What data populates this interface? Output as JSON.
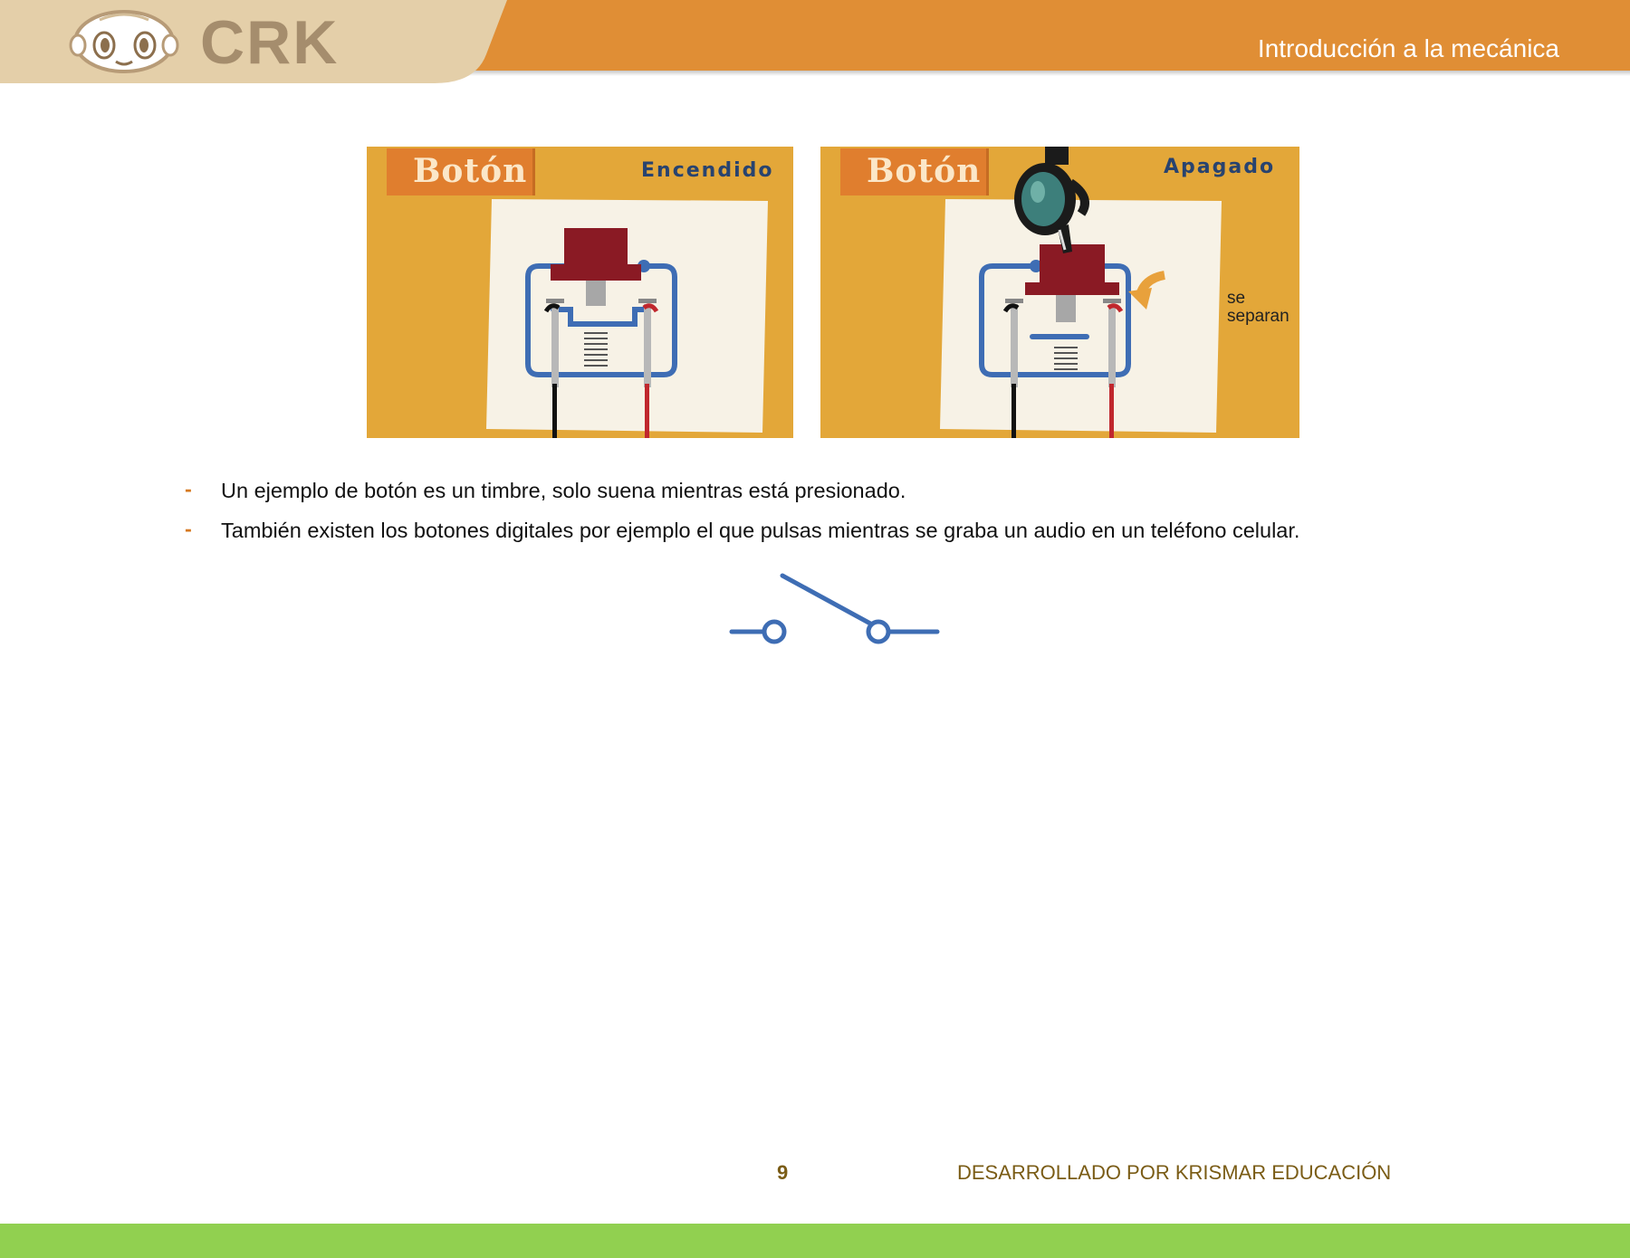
{
  "header": {
    "logo_text": "CRK",
    "title": "Introducción a la mecánica"
  },
  "figures": [
    {
      "tag": "Botón",
      "state": "Encendido"
    },
    {
      "tag": "Botón",
      "state": "Apagado",
      "annotation": [
        "se",
        "separan"
      ]
    }
  ],
  "bullets": [
    "Un ejemplo de botón es un timbre, solo suena mientras está presionado.",
    "También existen los botones digitales por ejemplo el que pulsas mientras se graba un audio en un teléfono celular."
  ],
  "footer": {
    "page_number": "9",
    "credit": "DESARROLLADO POR KRISMAR EDUCACIÓN"
  },
  "colors": {
    "header_orange": "#e08e35",
    "logo_beige": "#e4cfa9",
    "bullet_dash": "#d6791f",
    "footer_text": "#7a5c16",
    "bottom_band": "#91d050",
    "circuit_blue": "#3e6db4",
    "button_red": "#8a1a24"
  }
}
